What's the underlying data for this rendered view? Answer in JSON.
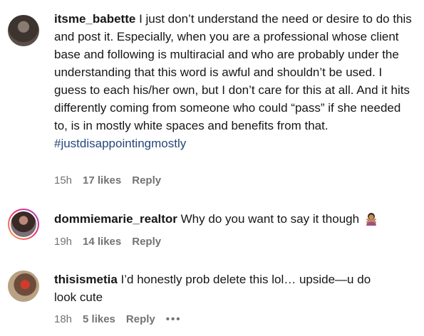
{
  "comments": [
    {
      "username": "itsme_babette",
      "body": "I just don’t understand the need or desire to do this and post it. Especially, when you are a professional whose client base and following is multiracial and who are probably under the understanding that this word is awful and shouldn’t be used. I guess to each his/her own, but I don’t care for this at all. And it hits differently coming from someone who could “pass” if she needed to, is in mostly white spaces and benefits from that.",
      "hashtag": "#justdisappointingmostly",
      "time": "15h",
      "likes": "17 likes",
      "reply": "Reply"
    },
    {
      "username": "dommiemarie_realtor",
      "body": "Why do you want to say it though",
      "emoji_icon": "woman-gesturing-no-icon",
      "time": "19h",
      "likes": "14 likes",
      "reply": "Reply"
    },
    {
      "username": "thisismetia",
      "body": "I’d honestly prob delete this lol… upside—u do look cute",
      "time": "18h",
      "likes": "5 likes",
      "reply": "Reply",
      "more": "•••"
    }
  ],
  "colors": {
    "text": "#161616",
    "meta": "#737373",
    "hashtag": "#25477a",
    "story_ring": "#e8367a"
  }
}
